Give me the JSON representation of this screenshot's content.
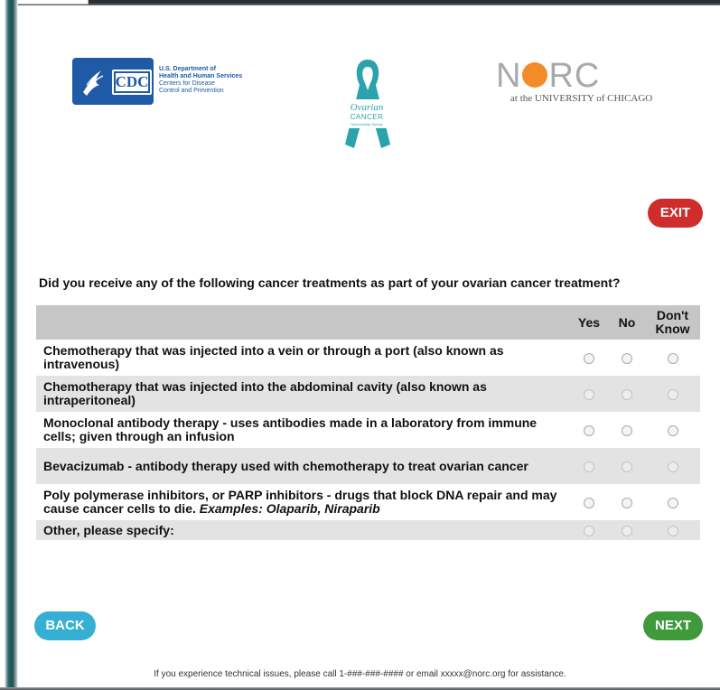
{
  "header": {
    "hhs_logo_lines": [
      "U.S. Department of",
      "Health and Human Services",
      "Centers for Disease",
      "Control and Prevention"
    ],
    "cdc_badge": "CDC",
    "ribbon_lines": [
      "Ovarian",
      "CANCER",
      "Survivorship Survey"
    ],
    "norc_name": "NORC",
    "norc_subtitle": "at the UNIVERSITY of CHICAGO"
  },
  "buttons": {
    "exit": "EXIT",
    "back": "BACK",
    "next": "NEXT"
  },
  "question": "Did you receive any of the following cancer treatments as part of your ovarian cancer treatment?",
  "table": {
    "columns": [
      "Yes",
      "No",
      "Don't Know"
    ],
    "rows": [
      {
        "label": "Chemotherapy that was injected into a vein or through a port (also known as intravenous)",
        "example": ""
      },
      {
        "label": "Chemotherapy that was injected into the abdominal cavity (also known as intraperitoneal)",
        "example": ""
      },
      {
        "label": "Monoclonal antibody therapy - uses antibodies made in a laboratory from immune cells; given through an infusion",
        "example": ""
      },
      {
        "label": "Bevacizumab - antibody therapy used with chemotherapy to treat ovarian cancer",
        "example": ""
      },
      {
        "label": "Poly polymerase inhibitors, or PARP inhibitors - drugs that block DNA repair and may cause cancer cells to die.",
        "example": "Examples: Olaparib, Niraparib"
      },
      {
        "label": "Other, please specify:",
        "example": ""
      }
    ]
  },
  "footer": "If you experience technical issues, please call 1-###-###-#### or email xxxxx@norc.org for assistance.",
  "colors": {
    "exit": "#cf2d2b",
    "back": "#36afd5",
    "next": "#3f9a3c",
    "header_row": "#c6c6c6",
    "shaded_row": "#e3e3e3",
    "ribbon": "#2ba3ad",
    "norc_dot": "#f28c28"
  }
}
